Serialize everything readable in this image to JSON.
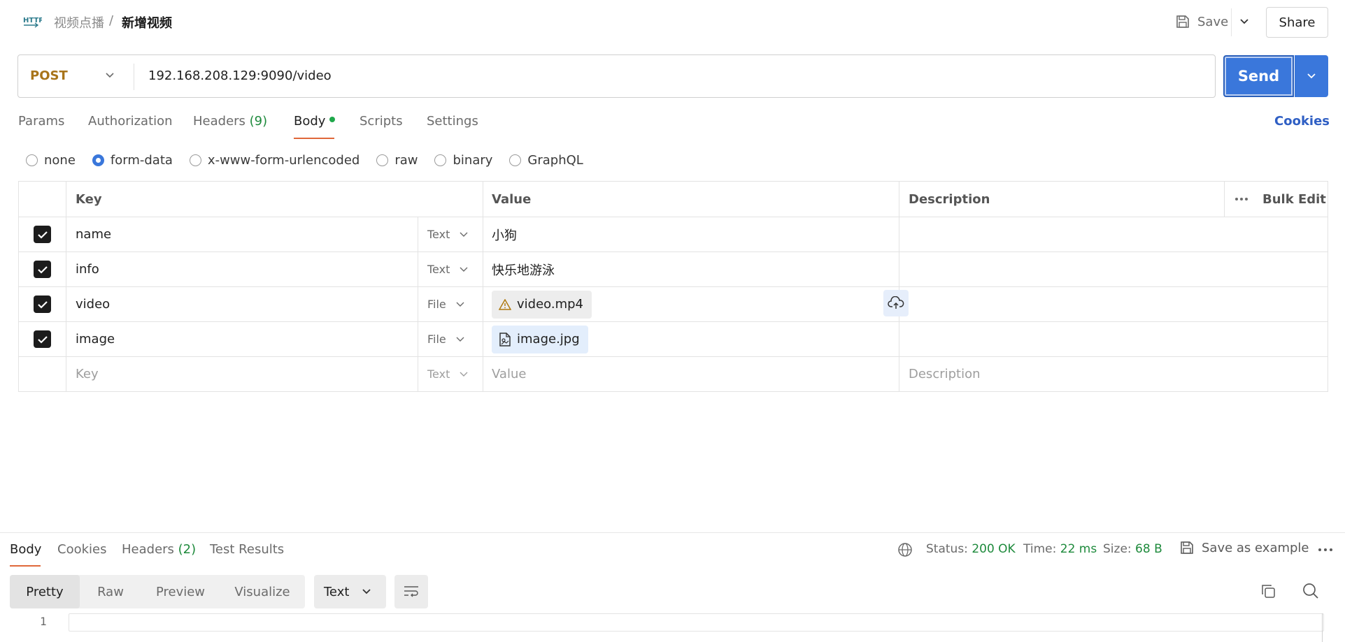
{
  "header": {
    "breadcrumb_parent": "视频点播",
    "breadcrumb_sep": "/",
    "breadcrumb_current": "新增视频",
    "save_label": "Save",
    "share_label": "Share"
  },
  "request": {
    "method": "POST",
    "url": "192.168.208.129:9090/video",
    "send_label": "Send"
  },
  "tabs": {
    "params": "Params",
    "authorization": "Authorization",
    "headers": "Headers",
    "headers_count": "(9)",
    "body": "Body",
    "scripts": "Scripts",
    "settings": "Settings",
    "cookies": "Cookies"
  },
  "body_types": {
    "none": "none",
    "form_data": "form-data",
    "urlencoded": "x-www-form-urlencoded",
    "raw": "raw",
    "binary": "binary",
    "graphql": "GraphQL",
    "selected": "form-data"
  },
  "table": {
    "headers": {
      "key": "Key",
      "value": "Value",
      "description": "Description",
      "bulk_edit": "Bulk Edit"
    },
    "rows": [
      {
        "checked": true,
        "key": "name",
        "type": "Text",
        "value": "小狗",
        "description": ""
      },
      {
        "checked": true,
        "key": "info",
        "type": "Text",
        "value": "快乐地游泳",
        "description": ""
      },
      {
        "checked": true,
        "key": "video",
        "type": "File",
        "value": "video.mp4",
        "description": ""
      },
      {
        "checked": true,
        "key": "image",
        "type": "File",
        "value": "image.jpg",
        "description": ""
      }
    ],
    "new_row": {
      "key_placeholder": "Key",
      "type": "Text",
      "value_placeholder": "Value",
      "description_placeholder": "Description"
    }
  },
  "response": {
    "tabs": {
      "body": "Body",
      "cookies": "Cookies",
      "headers": "Headers",
      "headers_count": "(2)",
      "test_results": "Test Results"
    },
    "status_label": "Status:",
    "status_value": "200 OK",
    "time_label": "Time:",
    "time_value": "22 ms",
    "size_label": "Size:",
    "size_value": "68 B",
    "save_example": "Save as example",
    "views": {
      "pretty": "Pretty",
      "raw": "Raw",
      "preview": "Preview",
      "visualize": "Visualize"
    },
    "format": "Text",
    "line_number": "1"
  },
  "colors": {
    "accent_blue": "#3a77db",
    "method_post": "#a8741a",
    "active_tab_underline": "#e0683a",
    "success_green": "#1e8a3c"
  }
}
